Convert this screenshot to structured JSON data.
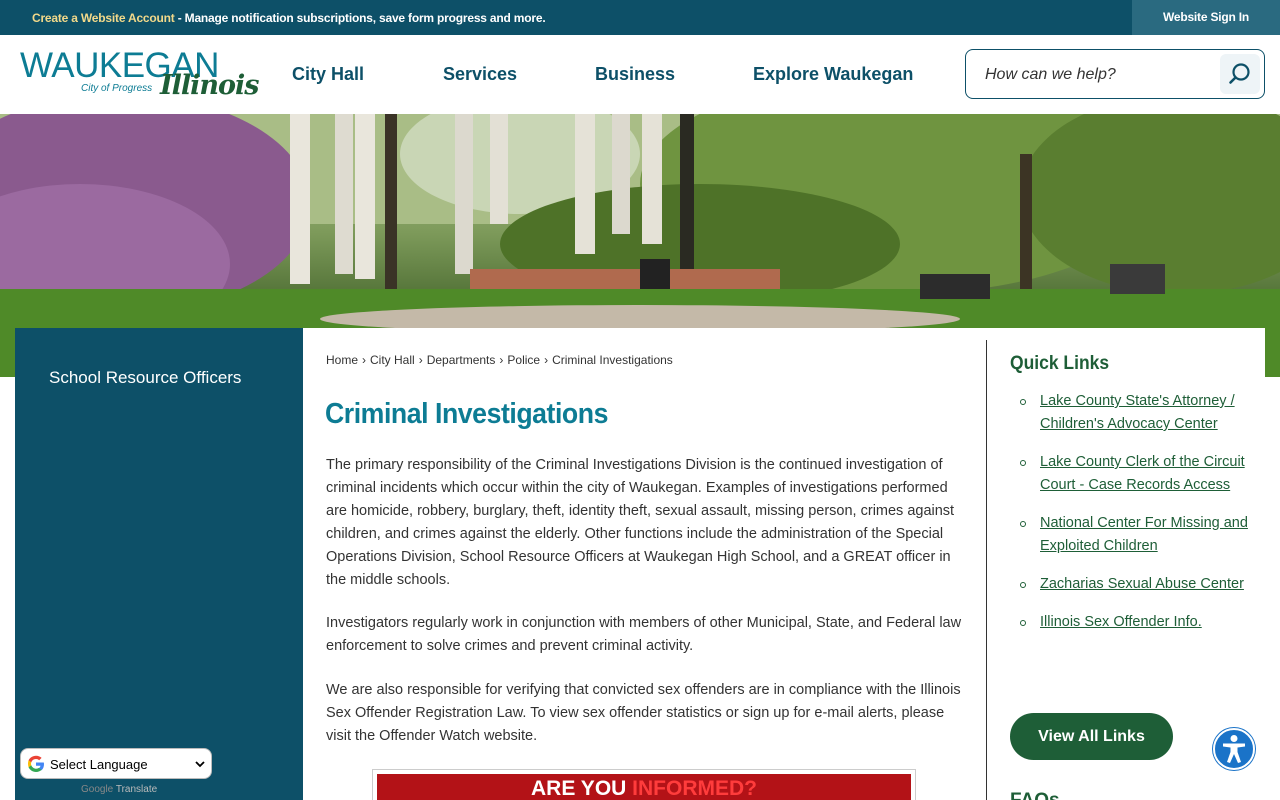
{
  "topbar": {
    "create_account": "Create a Website Account",
    "promo_text": " - Manage notification subscriptions, save form progress and more.",
    "sign_in": "Website Sign In"
  },
  "logo": {
    "wordmark": "WAUKEGAN",
    "tagline": "City of Progress",
    "state": "Illinois"
  },
  "nav": {
    "items": [
      "City Hall",
      "Services",
      "Business",
      "Explore Waukegan"
    ]
  },
  "search": {
    "placeholder": "How can we help?",
    "icon": "search-icon"
  },
  "sidebar": {
    "items": [
      "School Resource Officers"
    ]
  },
  "breadcrumb": [
    "Home",
    "City Hall",
    "Departments",
    "Police",
    "Criminal Investigations"
  ],
  "breadcrumb_separator": "›",
  "page": {
    "title": "Criminal Investigations",
    "paragraphs": [
      "The primary responsibility of the Criminal Investigations Division is the continued investigation of criminal incidents which occur within the city of Waukegan. Examples of investigations performed are homicide, robbery, burglary, theft, identity theft, sexual assault, missing person, crimes against children, and crimes against the elderly. Other functions include the administration of the Special Operations Division, School Resource Officers at Waukegan High School, and a GREAT officer in the middle schools.",
      "Investigators regularly work in conjunction with members of other Municipal, State, and Federal law enforcement to solve crimes and prevent criminal activity.",
      "We are also responsible for verifying that convicted sex offenders are in compliance with the Illinois Sex Offender Registration Law. To view sex offender statistics or sign up for e-mail alerts, please visit the Offender Watch website."
    ],
    "banner_part1": "ARE YOU ",
    "banner_part2": "INFORMED?"
  },
  "quick_links": {
    "title": "Quick Links",
    "items": [
      "Lake County State's Attorney / Children's Advocacy Center",
      "Lake County Clerk of the Circuit Court - Case Records Access",
      "National Center For Missing and Exploited Children",
      "Zacharias Sexual Abuse Center",
      "Illinois Sex Offender Info."
    ],
    "view_all": "View All Links",
    "next_section": "FAQs"
  },
  "translate": {
    "select_label": "Select Language",
    "powered_google": "Google",
    "powered_translate": "Translate"
  },
  "colors": {
    "brand_teal": "#0d5068",
    "title_teal": "#0d7c94",
    "link_green": "#1e5e37",
    "accessibility_blue": "#1a73c8"
  }
}
